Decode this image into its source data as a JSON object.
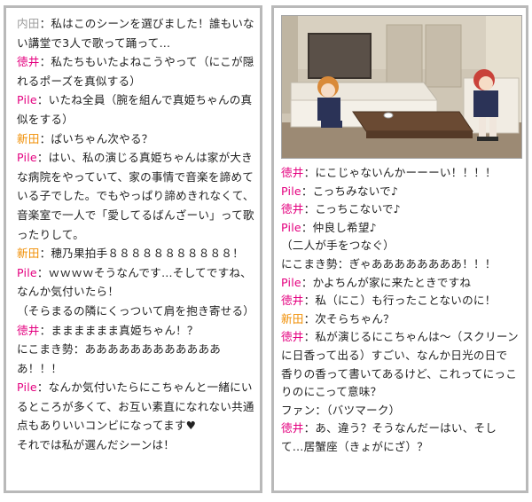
{
  "left_panel": {
    "lines": [
      {
        "speaker": "内田",
        "class": "spk-uchida",
        "text": "私はこのシーンを選びました！誰もいない講堂で3人で歌って踊って…"
      },
      {
        "speaker": "徳井",
        "class": "spk-tokui",
        "text": "私たちもいたよねこうやって（にこが隠れるポーズを真似する）"
      },
      {
        "speaker": "Pile",
        "class": "spk-pile",
        "text": "いたね全員（腕を組んで真姫ちゃんの真似をする）"
      },
      {
        "speaker": "新田",
        "class": "spk-nitta",
        "text": "ぱいちゃん次やる？"
      },
      {
        "speaker": "Pile",
        "class": "spk-pile",
        "text": "はい、私の演じる真姫ちゃんは家が大きな病院をやっていて、家の事情で音楽を諦めている子でした。でもやっぱり諦めきれなくて、音楽室で一人で「愛してるばんざーい」って歌ったりして。"
      },
      {
        "speaker": "新田",
        "class": "spk-nitta",
        "text": "穂乃果拍手８８８８８８８８８８８！"
      },
      {
        "speaker": "Pile",
        "class": "spk-pile",
        "text": "ｗｗｗｗそうなんです…そしてですね、なんか気付いたら！"
      },
      {
        "speaker": "",
        "class": "spk-none",
        "text": "（そらまるの隣にくっついて肩を抱き寄せる）"
      },
      {
        "speaker": "徳井",
        "class": "spk-tokui",
        "text": "まままままま真姫ちゃん！？"
      },
      {
        "speaker": "",
        "class": "spk-none",
        "text": "にこまき勢：あああああああああああああ！！！"
      },
      {
        "speaker": "Pile",
        "class": "spk-pile",
        "text": "なんか気付いたらにこちゃんと一緒にいるところが多くて、お互い素直になれない共通点もありいいコンビになってます♥"
      },
      {
        "speaker": "",
        "class": "spk-none",
        "text": "それでは私が選んだシーンは！"
      }
    ]
  },
  "right_panel": {
    "image_alt": "anime still: two girls on a sofa in a lounge room",
    "lines": [
      {
        "speaker": "徳井",
        "class": "spk-tokui",
        "text": "にこじゃないんかーーーい！！！！"
      },
      {
        "speaker": "Pile",
        "class": "spk-pile",
        "text": "こっちみないで♪"
      },
      {
        "speaker": "徳井",
        "class": "spk-tokui",
        "text": "こっちこないで♪"
      },
      {
        "speaker": "Pile",
        "class": "spk-pile",
        "text": "仲良し希望♪"
      },
      {
        "speaker": "",
        "class": "spk-none",
        "text": "（二人が手をつなぐ）"
      },
      {
        "speaker": "",
        "class": "spk-none",
        "text": "にこまき勢：ぎゃああああああああ！！！"
      },
      {
        "speaker": "Pile",
        "class": "spk-pile",
        "text": "かよちんが家に来たときですね"
      },
      {
        "speaker": "徳井",
        "class": "spk-tokui",
        "text": "私（にこ）も行ったことないのに！"
      },
      {
        "speaker": "新田",
        "class": "spk-nitta",
        "text": "次そらちゃん？"
      },
      {
        "speaker": "徳井",
        "class": "spk-tokui",
        "text": "私が演じるにこちゃんは～（スクリーンに日香って出る）すごい、なんか日光の日で香りの香って書いてあるけど、これってにっこりのにこって意味？"
      },
      {
        "speaker": "",
        "class": "spk-none",
        "text": "ファン：（バツマーク）"
      },
      {
        "speaker": "徳井",
        "class": "spk-tokui",
        "text": "あ、違う？そうなんだーはい、そして…居蟹座（きょがにざ）？"
      }
    ]
  },
  "colors": {
    "border": "#b9b9b9",
    "uchida": "#9a9a9a",
    "tokui": "#e4007f",
    "pile": "#e4007f",
    "nitta": "#f08d00"
  }
}
